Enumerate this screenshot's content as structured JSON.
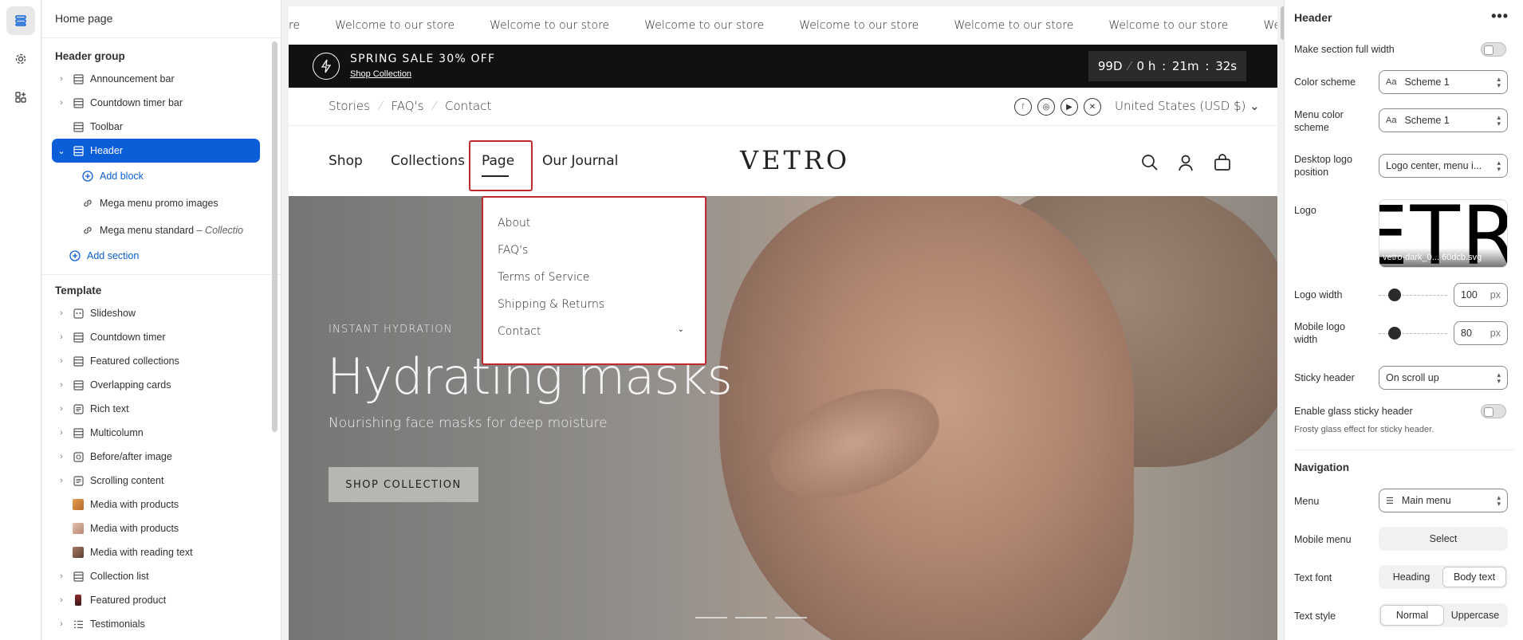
{
  "sidebar": {
    "title": "Home page",
    "header_group_label": "Header group",
    "header_items": [
      "Announcement bar",
      "Countdown timer bar",
      "Toolbar"
    ],
    "selected": "Header",
    "add_block": "Add block",
    "blocks": [
      {
        "label": "Mega menu promo images",
        "suffix": ""
      },
      {
        "label": "Mega menu standard",
        "suffix": "– Collectio"
      }
    ],
    "add_section": "Add section",
    "template_label": "Template",
    "template_items": [
      "Slideshow",
      "Countdown timer",
      "Featured collections",
      "Overlapping cards",
      "Rich text",
      "Multicolumn",
      "Before/after image",
      "Scrolling content",
      "Media with products",
      "Media with products",
      "Media with reading text",
      "Collection list",
      "Featured product",
      "Testimonials"
    ]
  },
  "preview": {
    "marquee_first": "re",
    "marquee_text": "Welcome to our store",
    "promo_title": "SPRING SALE 30% OFF",
    "promo_link": "Shop Collection",
    "timer": {
      "days": "99D",
      "hours": "0 h",
      "minutes": "21m",
      "seconds": "32s"
    },
    "utility_links": [
      "Stories",
      "FAQ's",
      "Contact"
    ],
    "utility_sep": "⁄",
    "socials": [
      "f",
      "◎",
      "▶",
      "✕"
    ],
    "currency": "United States (USD $) ⌄",
    "nav": [
      "Shop",
      "Collections",
      "Page",
      "Our Journal"
    ],
    "logo": "VETRO",
    "dropdown": [
      "About",
      "FAQ's",
      "Terms of Service",
      "Shipping & Returns",
      "Contact"
    ],
    "dropdown_caret": "⌄",
    "hero": {
      "eyebrow": "INSTANT HYDRATION",
      "title": "Hydrating masks",
      "subtitle": "Nourishing face masks for deep moisture",
      "cta": "SHOP COLLECTION"
    }
  },
  "panel": {
    "title": "Header",
    "more": "•••",
    "full_width_label": "Make section full width",
    "color_scheme_label": "Color scheme",
    "color_scheme_value": "Scheme 1",
    "menu_color_label": "Menu color scheme",
    "menu_color_value": "Scheme 1",
    "scheme_icon": "Aa",
    "desktop_logo_label": "Desktop logo position",
    "desktop_logo_value": "Logo center, menu i...",
    "logo_label": "Logo",
    "logo_preview": "ETR",
    "logo_file": "vetro-dark_0... 60dcb.svg",
    "logo_width_label": "Logo width",
    "logo_width_value": "100",
    "mobile_logo_label": "Mobile logo width",
    "mobile_logo_value": "80",
    "unit": "px",
    "sticky_label": "Sticky header",
    "sticky_value": "On scroll up",
    "glass_label": "Enable glass sticky header",
    "glass_hint": "Frosty glass effect for sticky header.",
    "nav_section": "Navigation",
    "menu_label": "Menu",
    "menu_value": "Main menu",
    "mobile_menu_label": "Mobile menu",
    "mobile_menu_value": "Select",
    "text_font_label": "Text font",
    "text_font_options": [
      "Heading",
      "Body text"
    ],
    "text_style_label": "Text style",
    "text_style_options": [
      "Normal",
      "Uppercase"
    ]
  },
  "colors": {
    "accent": "#0a5fd8",
    "highlight": "#c0282d",
    "promo_bg": "#111111"
  }
}
